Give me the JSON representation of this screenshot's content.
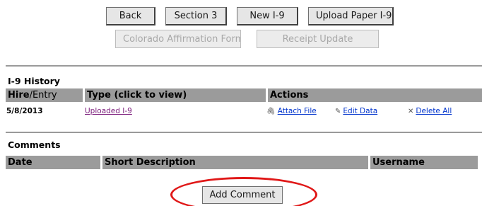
{
  "toolbar": {
    "back_label": "Back",
    "section3_label": "Section 3",
    "new_i9_label": "New I-9",
    "upload_paper_label": "Upload Paper I-9",
    "colorado_label": "Colorado Affirmation Form",
    "receipt_update_label": "Receipt Update"
  },
  "history": {
    "title": "I-9 History",
    "columns": {
      "hire_bold": "Hire",
      "hire_rest": "/Entry",
      "type": "Type (click to view)",
      "actions": "Actions"
    },
    "rows": [
      {
        "date": "5/8/2013",
        "type_link": "Uploaded I-9",
        "attach_label": "Attach File",
        "edit_label": "Edit Data",
        "delete_label": "Delete All"
      }
    ]
  },
  "comments": {
    "title": "Comments",
    "columns": {
      "date": "Date",
      "short_description": "Short Description",
      "username": "Username"
    },
    "add_label": "Add Comment"
  },
  "icons": {
    "attach": "paperclip-icon",
    "edit": "pencil-icon",
    "delete": "close-icon"
  },
  "colors": {
    "header_bg": "#9b9b9b",
    "link": "#0033cc",
    "visited_link": "#7a1a7a",
    "highlight_ellipse": "#e01818"
  }
}
